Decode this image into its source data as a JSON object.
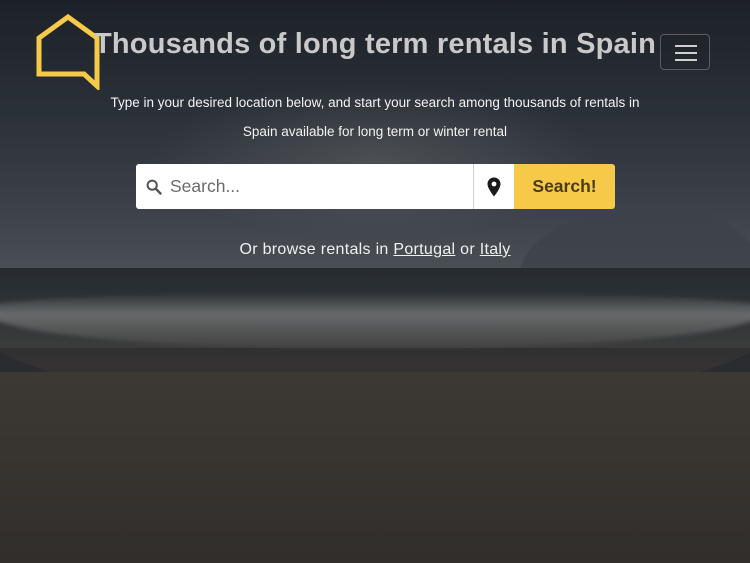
{
  "header": {
    "title": "Thousands of long term rentals in Spain",
    "logo_icon": "house-speech-bubble-icon",
    "logo_color": "#f7c948",
    "menu_icon": "hamburger-menu-icon"
  },
  "intro": {
    "line1": "Type in your desired location below, and start your search among thousands of rentals in",
    "line2": "Spain available for long term or winter rental"
  },
  "search": {
    "placeholder": "Search...",
    "value": "",
    "search_icon": "search-icon",
    "location_icon": "map-pin-icon",
    "button_label": "Search!",
    "button_color": "#f7c948"
  },
  "browse": {
    "prefix": "Or browse rentals in ",
    "link1": "Portugal",
    "connector": " or ",
    "link2": "Italy"
  }
}
